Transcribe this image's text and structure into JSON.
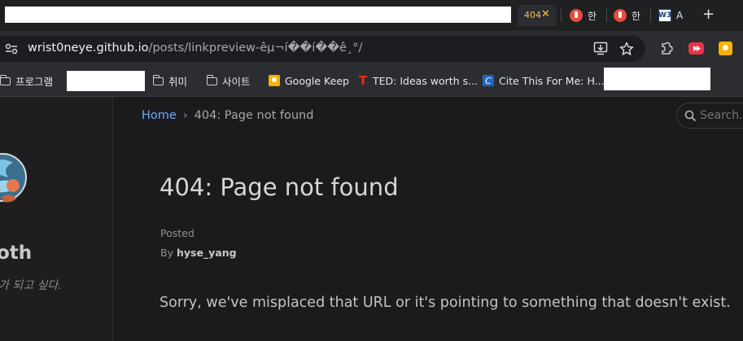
{
  "tabs": [
    {
      "label": "404",
      "active": true
    },
    {
      "label": "한",
      "active": false
    },
    {
      "label": "한",
      "active": false
    },
    {
      "label": "A",
      "active": false,
      "icon_text": "W3"
    }
  ],
  "address": {
    "domain": "wrist0neye.github.io",
    "path": "/posts/linkpreview-êµ¬í��í��ê¸°/"
  },
  "bookmarks": [
    {
      "label": "프로그램",
      "icon": "folder-icon"
    },
    {
      "label": "취미",
      "icon": "folder-icon"
    },
    {
      "label": "사이트",
      "icon": "folder-icon"
    },
    {
      "label": "Google Keep",
      "icon": "google-keep-icon"
    },
    {
      "label": "TED: Ideas worth s...",
      "icon": "ted-icon"
    },
    {
      "label": "Cite This For Me: H...",
      "icon": "cite-this-for-me-icon"
    }
  ],
  "sidebar": {
    "site_title_partial": "oth",
    "tagline_partial": "가 되고 싶다."
  },
  "breadcrumb": {
    "home": "Home",
    "separator": "›",
    "current": "404: Page not found"
  },
  "search": {
    "placeholder": "Search..."
  },
  "post": {
    "title": "404: Page not found",
    "posted_label": "Posted",
    "by_label": "By",
    "author": "hyse_yang",
    "message": "Sorry, we've misplaced that URL or it's pointing to something that doesn't exist."
  },
  "colors": {
    "tab_active_accent": "#f6c344",
    "link_blue": "#6ea8fe",
    "page_bg": "#1b1b1e"
  }
}
